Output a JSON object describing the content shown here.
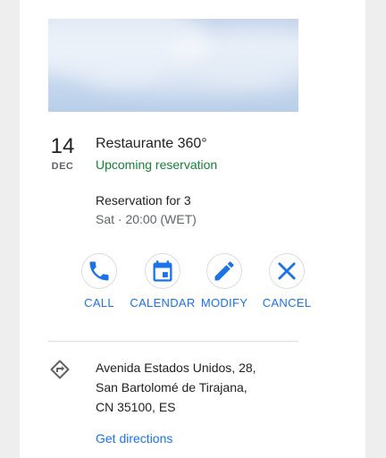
{
  "reservation": {
    "day": "14",
    "month": "DEC",
    "restaurant_name": "Restaurante 360°",
    "status": "Upcoming reservation",
    "party": "Reservation for 3",
    "time": "Sat · 20:00 (WET)"
  },
  "actions": [
    {
      "label": "CALL",
      "icon": "phone-icon"
    },
    {
      "label": "CALENDAR",
      "icon": "calendar-icon"
    },
    {
      "label": "MODIFY",
      "icon": "pencil-icon"
    },
    {
      "label": "CANCEL",
      "icon": "close-icon"
    }
  ],
  "address": {
    "line1": "Avenida Estados Unidos, 28,",
    "line2": "San Bartolomé de Tirajana,",
    "line3": "CN 35100, ES",
    "directions_label": "Get directions",
    "icon": "directions-icon"
  },
  "colors": {
    "accent": "#1a73e8",
    "status_green": "#188038",
    "text_primary": "#202124",
    "text_secondary": "#5f6368",
    "background": "#eeeeee",
    "divider": "#dadce0"
  }
}
